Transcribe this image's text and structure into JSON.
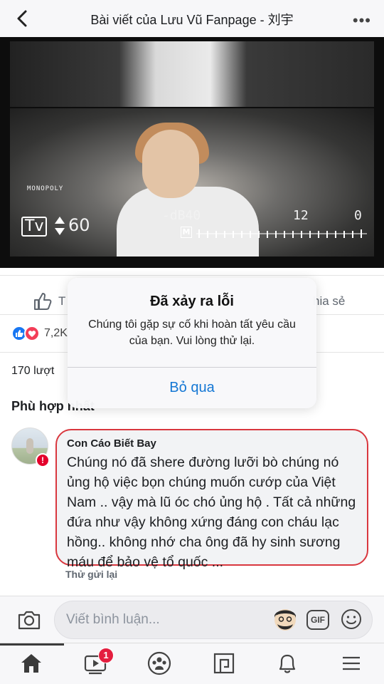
{
  "header": {
    "title": "Bài viết của Lưu Vũ Fanpage - 刘宇",
    "more_label": "•••"
  },
  "photo": {
    "brand_text": "MONOPOLY",
    "tv_label": "Tv",
    "tv_value": "60",
    "db_value": "-dB40",
    "meter_mid": "12",
    "meter_end": "0",
    "m_label": "M"
  },
  "actions": {
    "like_label": "T",
    "share_label": "hia sẻ"
  },
  "reactions": {
    "count": "7,2K"
  },
  "post": {
    "views": "170 lượt",
    "relevant_label": "Phù hợp nhất"
  },
  "comment": {
    "author": "Con Cáo Biết Bay",
    "text": "Chúng nó đã shere đường lưỡi bò chúng nó ủng hộ việc bọn chúng muốn cướp của Việt Nam .. vậy mà lũ óc chó ủng hộ . Tất cả những đứa như vậy không xứng đáng con cháu lạc hồng.. không nhớ cha ông đã hy sinh sương máu để bảo vệ tổ quốc ...",
    "retry_label": "Thử gửi lại",
    "error_badge": "!"
  },
  "composer": {
    "placeholder": "Viết bình luận...",
    "gif_label": "GIF"
  },
  "tabbar": {
    "watch_badge": "1"
  },
  "alert": {
    "title": "Đã xảy ra lỗi",
    "message": "Chúng tôi gặp sự cố khi hoàn tất yêu cầu của bạn. Vui lòng thử lại.",
    "button": "Bỏ qua"
  },
  "colors": {
    "accent_blue": "#1477d4",
    "error_red": "#d9373e",
    "badge_red": "#e41e3f"
  }
}
